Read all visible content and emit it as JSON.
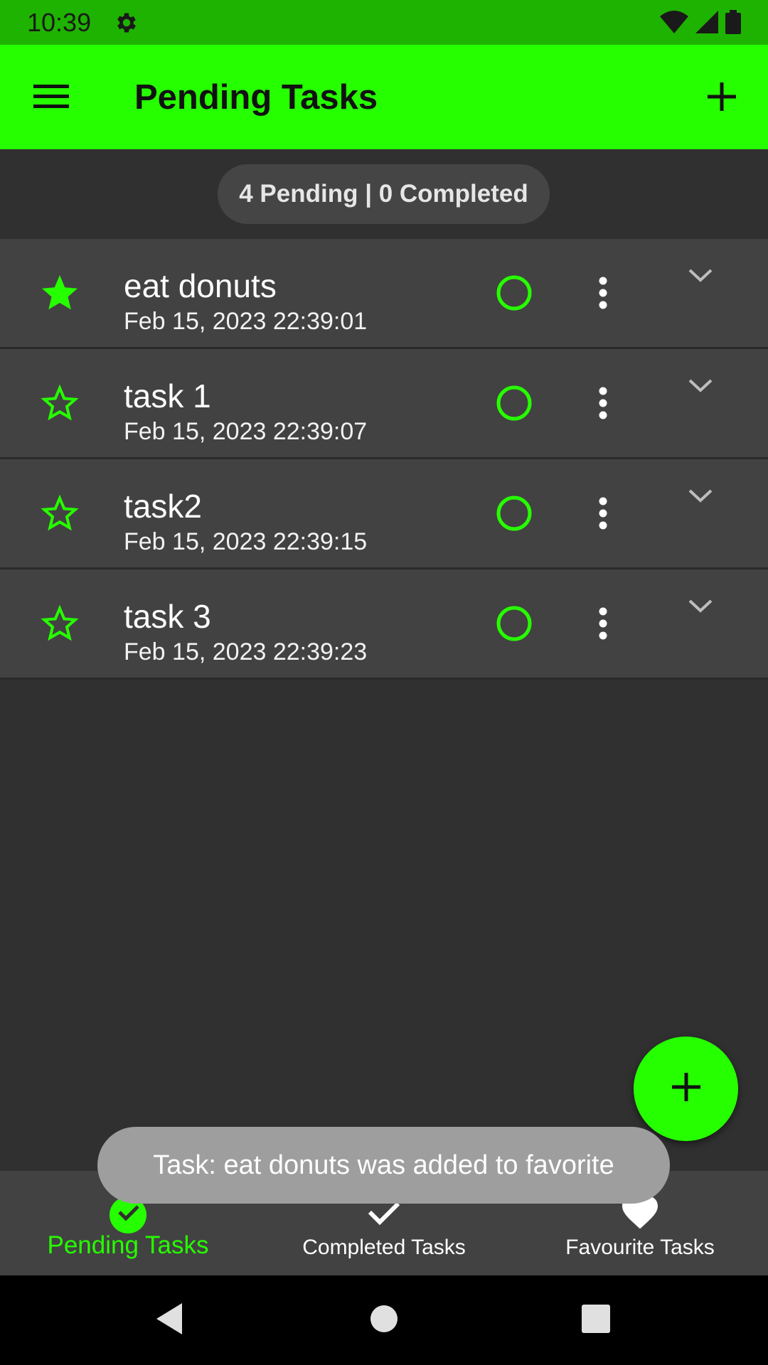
{
  "status_bar": {
    "time": "10:39",
    "icons": [
      "settings-icon",
      "wifi-icon",
      "signal-icon",
      "battery-icon"
    ]
  },
  "app_bar": {
    "title": "Pending Tasks",
    "menu_icon": "hamburger-menu-icon",
    "action_icon": "plus-icon"
  },
  "summary": {
    "text": "4 Pending | 0 Completed"
  },
  "tasks": [
    {
      "title": "eat donuts",
      "date": "Feb 15, 2023 22:39:01",
      "favorite": true
    },
    {
      "title": "task 1",
      "date": "Feb 15, 2023 22:39:07",
      "favorite": false
    },
    {
      "title": "task2",
      "date": "Feb 15, 2023 22:39:15",
      "favorite": false
    },
    {
      "title": "task 3",
      "date": "Feb 15, 2023 22:39:23",
      "favorite": false
    }
  ],
  "fab": {
    "icon": "plus-icon"
  },
  "bottom_nav": {
    "items": [
      {
        "label": "Pending Tasks",
        "icon": "pending-icon",
        "active": true
      },
      {
        "label": "Completed Tasks",
        "icon": "check-icon",
        "active": false
      },
      {
        "label": "Favourite Tasks",
        "icon": "heart-icon",
        "active": false
      }
    ]
  },
  "toast": {
    "text": "Task: eat donuts was added to favorite"
  },
  "colors": {
    "accent": "#26ff00",
    "status_bar": "#1eb300",
    "background": "#303030",
    "card": "#424242",
    "toast": "#9e9e9e"
  },
  "system_nav": {
    "icons": [
      "back-icon",
      "home-icon",
      "recents-icon"
    ]
  }
}
